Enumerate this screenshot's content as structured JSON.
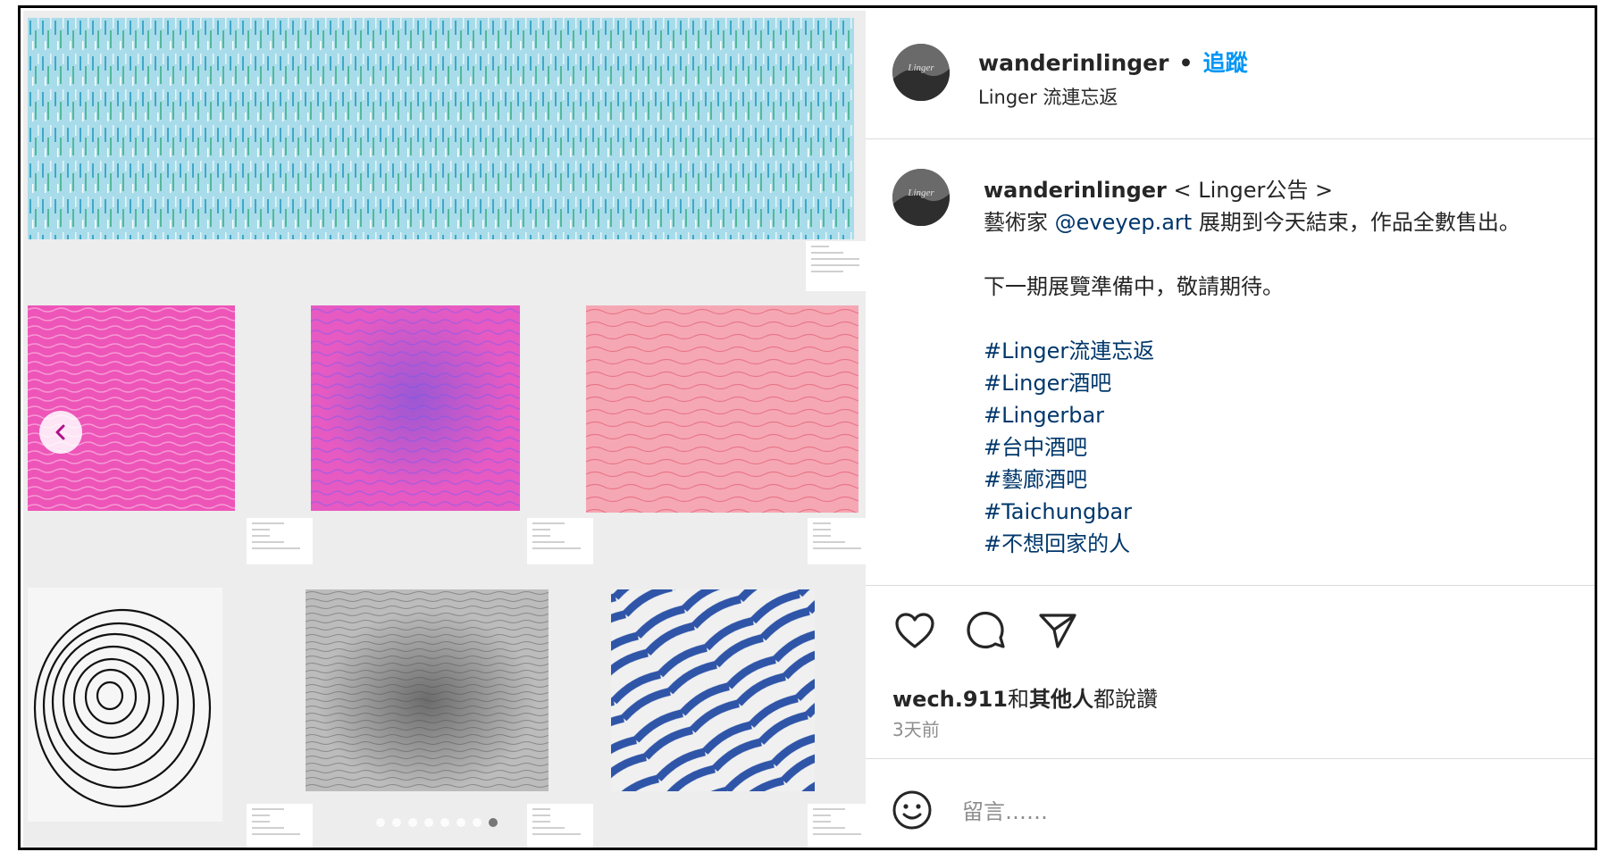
{
  "header": {
    "username": "wanderinlinger",
    "separator": "•",
    "follow_label": "追蹤",
    "subtitle": "Linger 流連忘返"
  },
  "caption": {
    "username": "wanderinlinger",
    "title": " < Linger公告 >",
    "line1_pre": "藝術家 ",
    "mention": "@eveyep.art",
    "line1_post": " 展期到今天結束，作品全數售出。",
    "line2": "下一期展覽準備中，敬請期待。",
    "hashtags": [
      "#Linger流連忘返",
      "#Linger酒吧",
      "#Lingerbar",
      "#台中酒吧",
      "#藝廊酒吧",
      "#Taichungbar",
      "#不想回家的人"
    ]
  },
  "likes": {
    "user": "wech.911",
    "mid": "和",
    "others": "其他人",
    "suffix": "都說讚"
  },
  "time": "3天前",
  "comment": {
    "placeholder": "留言……"
  },
  "avatar_logo": "Linger",
  "carousel": {
    "total": 8,
    "active_index": 7
  },
  "icons": [
    "chevron-left-icon",
    "heart-icon",
    "comment-icon",
    "share-icon",
    "emoji-icon"
  ],
  "colors": {
    "link": "#0095f6",
    "tag": "#00376b",
    "muted": "#8e8e8e",
    "divider": "#dbdbdb"
  }
}
